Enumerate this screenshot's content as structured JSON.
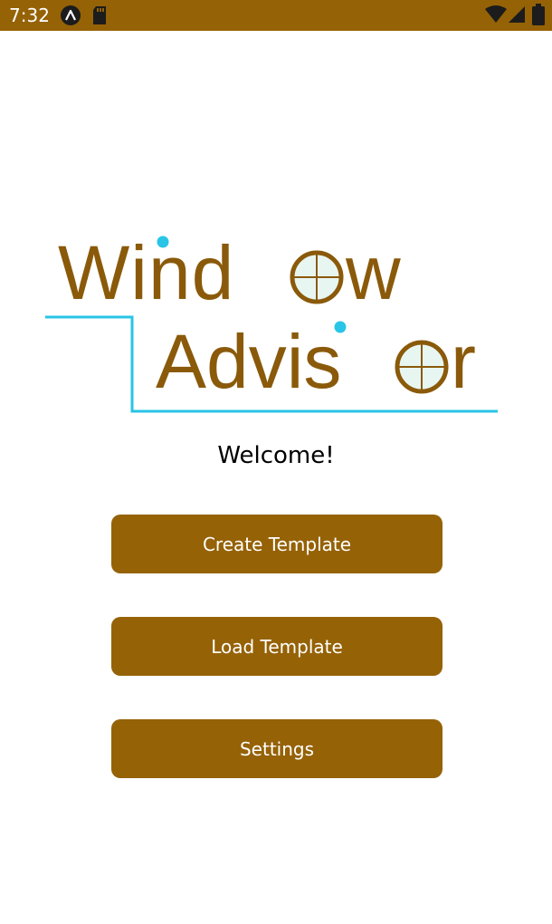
{
  "status_bar": {
    "time": "7:32",
    "color": "#956206",
    "left_icons": [
      "app-notification-icon",
      "sd-card-icon"
    ],
    "right_icons": [
      "wifi-icon",
      "signal-icon",
      "battery-icon"
    ]
  },
  "logo": {
    "line1": "Window",
    "line2": "Advisor",
    "text_color": "#8a5a0a",
    "accent_color": "#29c5e6"
  },
  "welcome_text": "Welcome!",
  "buttons": {
    "create": "Create Template",
    "load": "Load Template",
    "settings": "Settings"
  },
  "button_color": "#956206"
}
